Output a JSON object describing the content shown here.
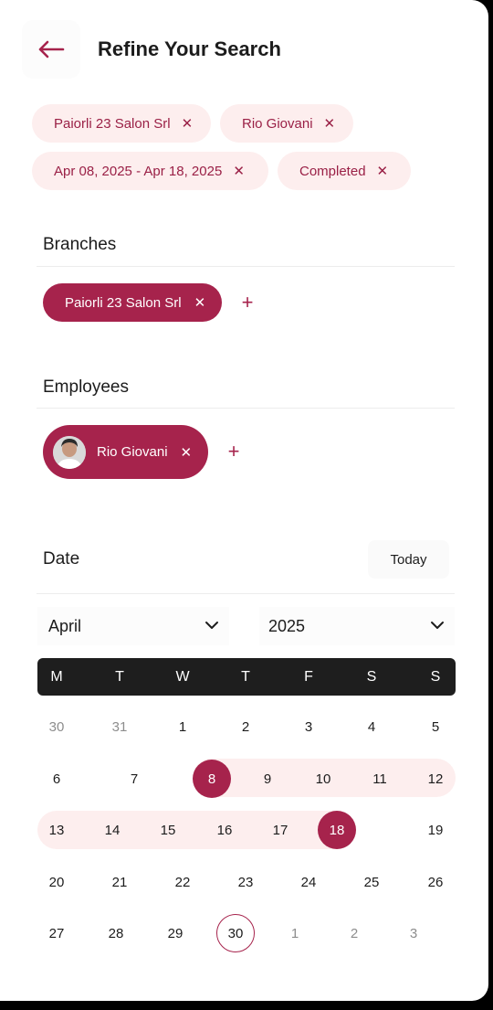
{
  "header": {
    "title": "Refine Your Search",
    "back_icon": "arrow-left-icon"
  },
  "filter_chips": [
    {
      "label": "Paiorli 23 Salon Srl"
    },
    {
      "label": "Rio Giovani"
    },
    {
      "label": "Apr 08, 2025 - Apr 18, 2025"
    },
    {
      "label": "Completed"
    }
  ],
  "branches": {
    "title": "Branches",
    "selected": "Paiorli 23 Salon Srl"
  },
  "employees": {
    "title": "Employees",
    "selected": "Rio Giovani"
  },
  "date": {
    "title": "Date",
    "today_label": "Today",
    "month": "April",
    "year": "2025",
    "weekdays": [
      "M",
      "T",
      "W",
      "T",
      "F",
      "S",
      "S"
    ],
    "weeks": [
      [
        {
          "d": "30",
          "muted": true
        },
        {
          "d": "31",
          "muted": true
        },
        {
          "d": "1"
        },
        {
          "d": "2"
        },
        {
          "d": "3"
        },
        {
          "d": "4"
        },
        {
          "d": "5"
        }
      ],
      [
        {
          "d": "6"
        },
        {
          "d": "7"
        },
        {
          "d": "8",
          "sel": true
        },
        {
          "d": "9"
        },
        {
          "d": "10"
        },
        {
          "d": "11"
        },
        {
          "d": "12"
        }
      ],
      [
        {
          "d": "13"
        },
        {
          "d": "14"
        },
        {
          "d": "15"
        },
        {
          "d": "16"
        },
        {
          "d": "17"
        },
        {
          "d": "18",
          "sel": true
        },
        {
          "d": "19"
        }
      ],
      [
        {
          "d": "20"
        },
        {
          "d": "21"
        },
        {
          "d": "22"
        },
        {
          "d": "23"
        },
        {
          "d": "24"
        },
        {
          "d": "25"
        },
        {
          "d": "26"
        }
      ],
      [
        {
          "d": "27"
        },
        {
          "d": "28"
        },
        {
          "d": "29"
        },
        {
          "d": "30",
          "today": true
        },
        {
          "d": "1",
          "muted": true
        },
        {
          "d": "2",
          "muted": true
        },
        {
          "d": "3",
          "muted": true
        }
      ]
    ]
  },
  "colors": {
    "accent": "#a6234c",
    "chip_bg": "#fdeeee",
    "header_bar": "#1e1e1e"
  }
}
